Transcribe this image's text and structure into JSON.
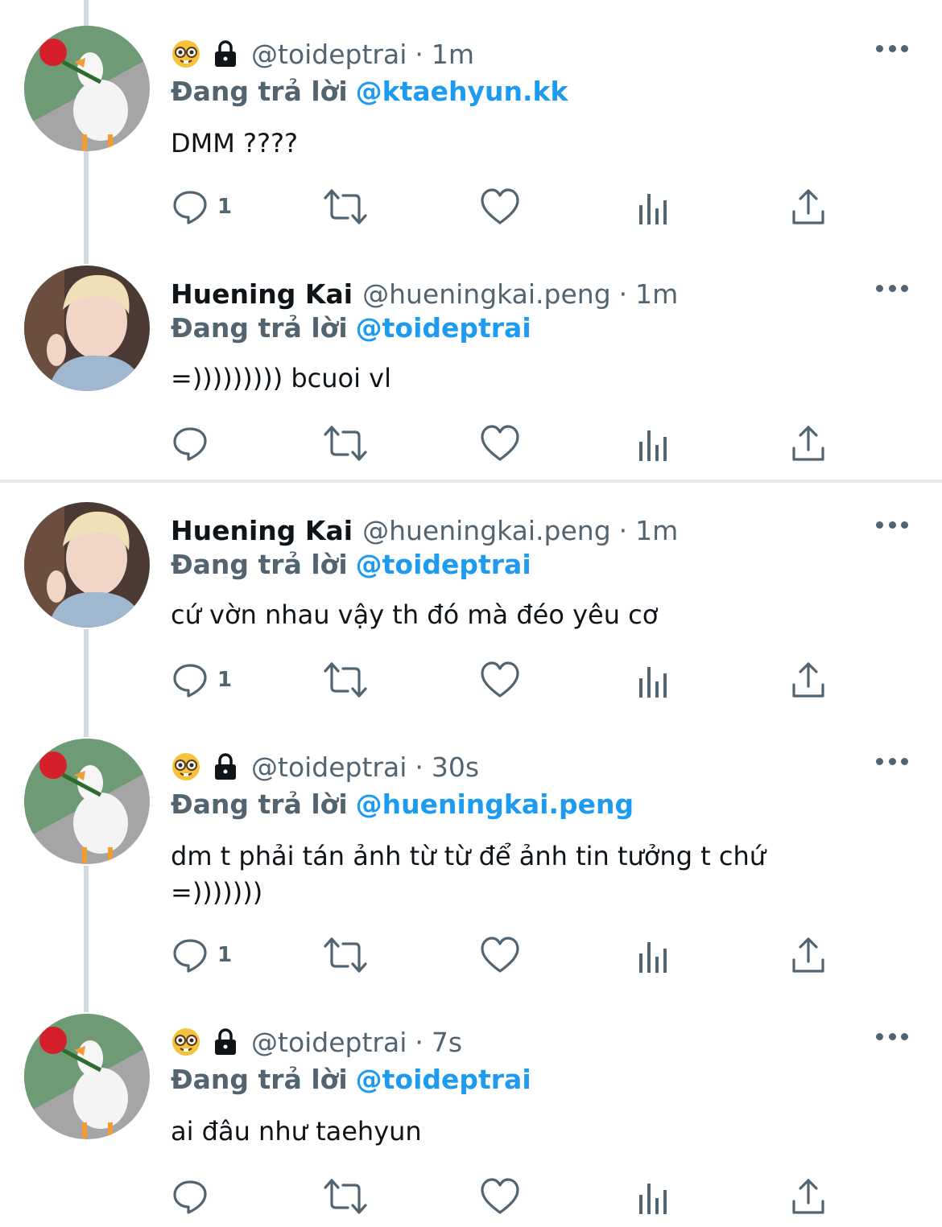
{
  "colors": {
    "link_blue": "#1d9bf0",
    "secondary_text": "#536471",
    "primary_text": "#0f1419",
    "thread_line": "#cfd9de"
  },
  "reply_prefix": "Đang trả lời",
  "tweets": [
    {
      "avatar": "goose-with-rose-avatar",
      "name": "",
      "badges": [
        "nerd-face-emoji",
        "lock-icon"
      ],
      "handle": "@toideptrai",
      "separator": "·",
      "time": "1m",
      "reply_to": "@ktaehyun.kk",
      "text": "DMM ????",
      "reply_count": "1"
    },
    {
      "avatar": "person-photo-avatar",
      "name": "Huening Kai",
      "badges": [],
      "handle": "@hueningkai.peng",
      "separator": "·",
      "time": "1m",
      "reply_to": "@toideptrai",
      "text": "=))))))))) bcuoi vl",
      "reply_count": ""
    },
    {
      "avatar": "person-photo-avatar",
      "name": "Huening Kai",
      "badges": [],
      "handle": "@hueningkai.peng",
      "separator": "·",
      "time": "1m",
      "reply_to": "@toideptrai",
      "text": "cứ vờn nhau vậy th đó mà đéo yêu cơ",
      "reply_count": "1"
    },
    {
      "avatar": "goose-with-rose-avatar",
      "name": "",
      "badges": [
        "nerd-face-emoji",
        "lock-icon"
      ],
      "handle": "@toideptrai",
      "separator": "·",
      "time": "30s",
      "reply_to": "@hueningkai.peng",
      "text": "dm t phải tán ảnh từ từ để ảnh tin tưởng t chứ\n=)))))))",
      "reply_count": "1"
    },
    {
      "avatar": "goose-with-rose-avatar",
      "name": "",
      "badges": [
        "nerd-face-emoji",
        "lock-icon"
      ],
      "handle": "@toideptrai",
      "separator": "·",
      "time": "7s",
      "reply_to": "@toideptrai",
      "text": "ai đâu như taehyun",
      "reply_count": ""
    }
  ]
}
